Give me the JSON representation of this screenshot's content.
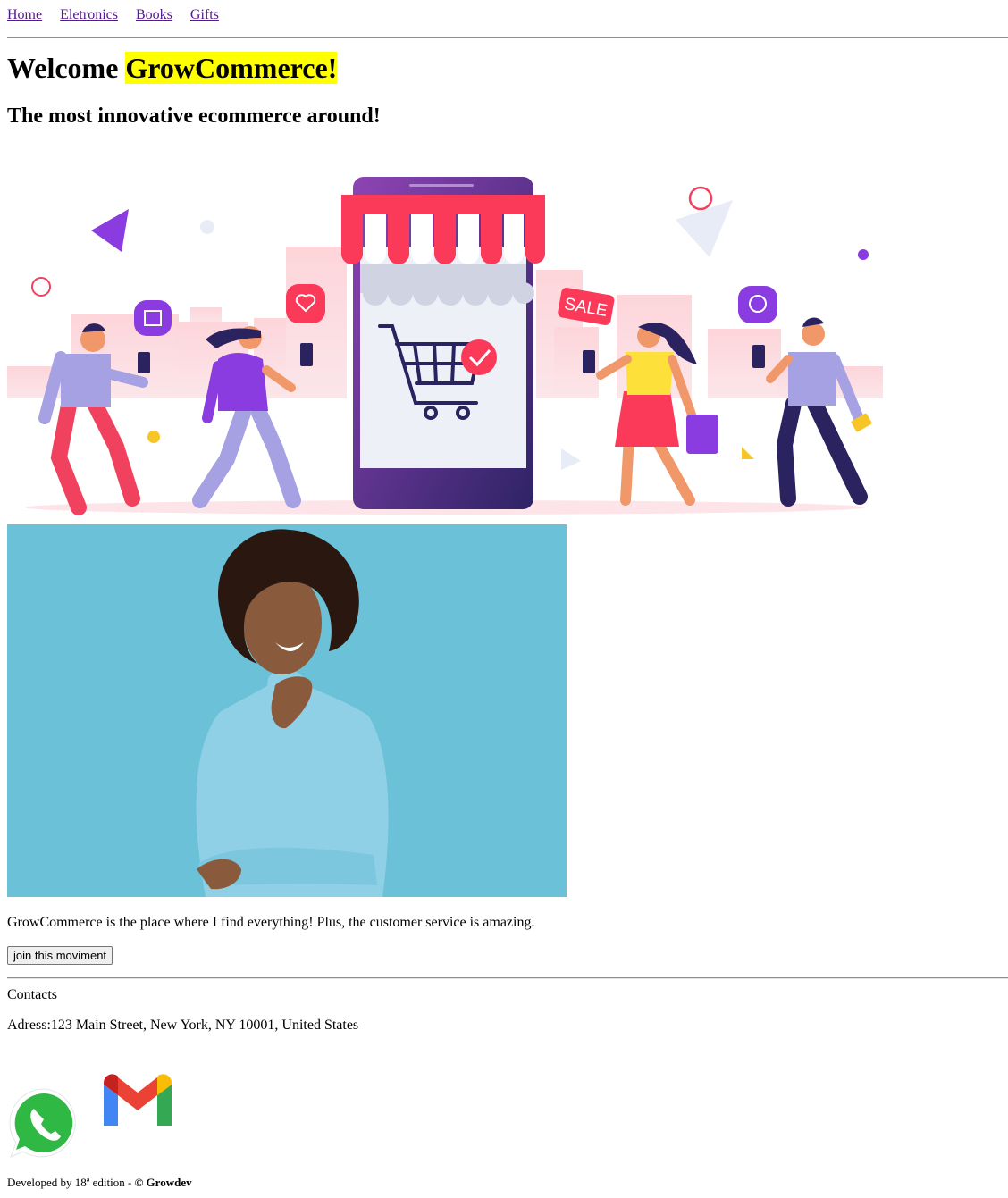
{
  "nav": {
    "links": [
      "Home",
      "Eletronics",
      "Books",
      "Gifts"
    ]
  },
  "header": {
    "welcome": "Welcome",
    "brand": "GrowCommerce!",
    "subtitle": "The most innovative ecommerce around!"
  },
  "hero": {
    "sale_tag": "SALE"
  },
  "testimonial": {
    "text": "GrowCommerce is the place where I find everything! Plus, the customer service is amazing.",
    "button_label": "join this moviment"
  },
  "contacts": {
    "heading": "Contacts",
    "address": "Adress:123 Main Street, New York, NY 10001, United States",
    "icons": [
      "whatsapp-icon",
      "gmail-icon"
    ]
  },
  "footer": {
    "prefix": "Developed by 18ª edition - ",
    "brand": "© Growdev"
  },
  "colors": {
    "highlight": "#ffff00",
    "link": "#551a8b",
    "accent_red": "#fb3a5a",
    "accent_purple": "#7b2fd0",
    "photo_bg": "#63bdd4"
  }
}
